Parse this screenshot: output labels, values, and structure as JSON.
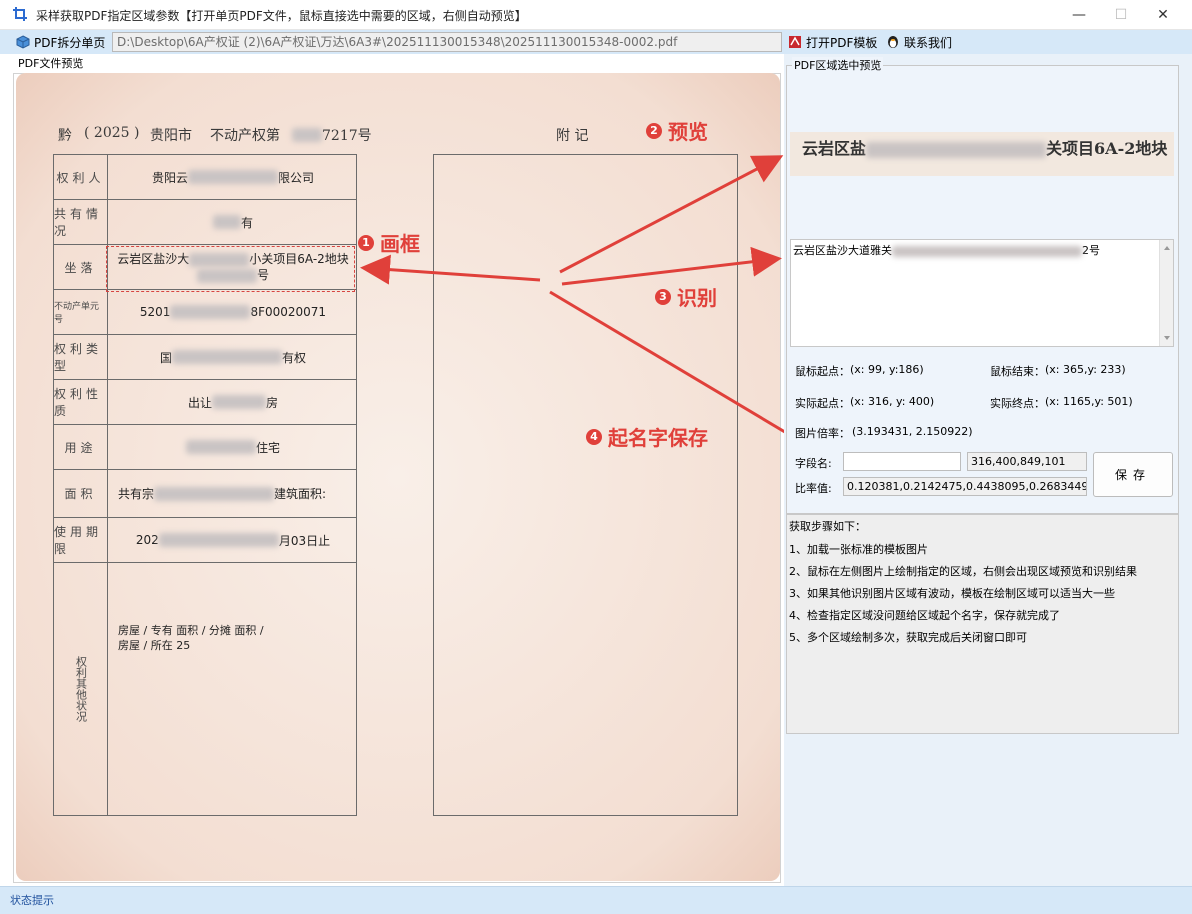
{
  "window": {
    "title": "采样获取PDF指定区域参数【打开单页PDF文件，鼠标直接选中需要的区域，右侧自动预览】",
    "minimize": "—",
    "maximize": "☐",
    "close": "✕"
  },
  "toolbar": {
    "split_button": "PDF拆分单页",
    "file_path": "D:\\Desktop\\6A产权证 (2)\\6A产权证\\万达\\6A3#\\202511130015348\\202511130015348-0002.pdf",
    "open_template_button": "打开PDF模板",
    "contact_button": "联系我们"
  },
  "left": {
    "label": "PDF文件预览",
    "doc": {
      "header_prefix": "黔",
      "header_year": "( 2025 )",
      "header_city": "贵阳市",
      "header_type": "不动产权第",
      "header_num": "7217号",
      "right_header": "附   记",
      "rows": [
        {
          "label": "权利人",
          "value_pre": "贵阳云",
          "value_post": "限公司"
        },
        {
          "label": "共有情况",
          "value_pre": "",
          "value_post": "有"
        },
        {
          "label": "坐落",
          "value_pre": "云岩区盐沙大",
          "value_post": "小关项目6A-2地块"
        },
        {
          "label": "不动产单元号",
          "value_pre": "5201",
          "value_post": "8F00020071"
        },
        {
          "label": "权利类型",
          "value_pre": "国",
          "value_post": "有权"
        },
        {
          "label": "权利性质",
          "value_pre": "出让",
          "value_post": "房"
        },
        {
          "label": "用途",
          "value_pre": "",
          "value_post": "住宅"
        },
        {
          "label": "面积",
          "value_pre": "共有宗",
          "value_post": "建筑面积:"
        },
        {
          "label": "使用期限",
          "value_pre": "202",
          "value_post": "月03日止"
        },
        {
          "label": "权利其他状况",
          "value_pre": "房屋 / 专有 面积 / 分摊 面积 / 房屋 / 所在 25",
          "value_post": ""
        }
      ],
      "row3_line2": "号"
    }
  },
  "annotations": {
    "a1": {
      "num": "1",
      "text": "画框"
    },
    "a2": {
      "num": "2",
      "text": "预览"
    },
    "a3": {
      "num": "3",
      "text": "识别"
    },
    "a4": {
      "num": "4",
      "text": "起名字保存"
    }
  },
  "right": {
    "label": "PDF区域选中预览",
    "preview_text": "云岩区盐",
    "preview_text_end": "关项目6A-2地块",
    "ocr_text": "云岩区盐沙大道雅关",
    "ocr_text_end": "2号",
    "mouse_start_label": "鼠标起点：",
    "mouse_start_value": "(x: 99, y:186)",
    "mouse_end_label": "鼠标结束：",
    "mouse_end_value": "(x: 365,y: 233)",
    "actual_start_label": "实际起点：",
    "actual_start_value": "(x: 316, y: 400)",
    "actual_end_label": "实际终点：",
    "actual_end_value": "(x: 1165,y: 501)",
    "scale_label": "图片倍率：",
    "scale_value": "(3.193431, 2.150922)",
    "field_name_label": "字段名:",
    "field_name_value": "",
    "coords_value": "316,400,849,101",
    "ratio_label": "比率值:",
    "ratio_value": "0.120381,0.2142475,0.4438095,0.2683449",
    "save_button": "保存",
    "steps_title": "获取步骤如下：",
    "steps": [
      "1、加载一张标准的模板图片",
      "2、鼠标在左侧图片上绘制指定的区域，右侧会出现区域预览和识别结果",
      "3、如果其他识别图片区域有波动，模板在绘制区域可以适当大一些",
      "4、检查指定区域没问题给区域起个名字，保存就完成了",
      "5、多个区域绘制多次，获取完成后关闭窗口即可"
    ]
  },
  "status": {
    "text": "状态提示"
  },
  "colors": {
    "accent_red": "#e0403a",
    "toolbar_bg": "#d6e8f8",
    "status_text": "#1e4f9c"
  }
}
